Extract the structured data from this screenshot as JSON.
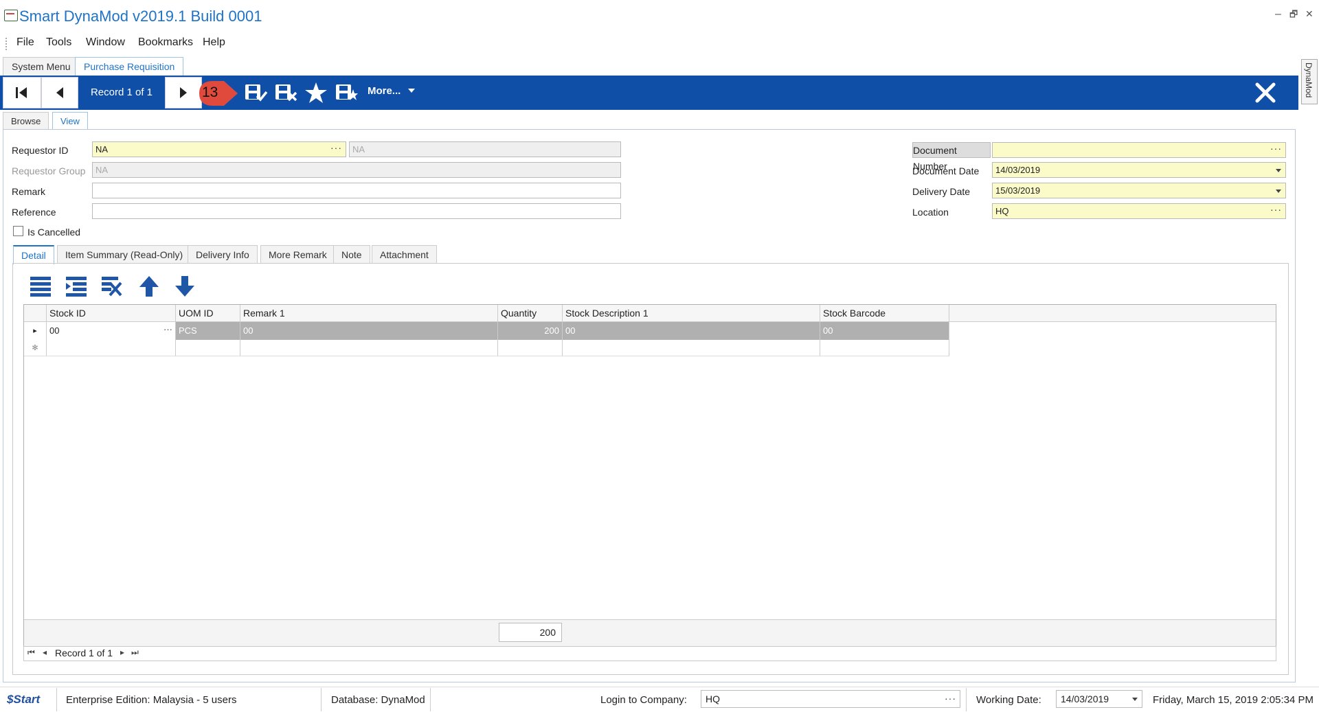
{
  "window": {
    "title": "Smart DynaMod v2019.1 Build 0001",
    "minimize_glyph": "–",
    "restore_glyph": "🗗",
    "close_glyph": "✕"
  },
  "menu": [
    "File",
    "Tools",
    "Window",
    "Bookmarks",
    "Help"
  ],
  "doc_tabs": [
    "System Menu",
    "Purchase Requisition"
  ],
  "side_tab": "DynaMod",
  "toolbar": {
    "record_label": "Record 1 of 1",
    "callout_number": "13",
    "more_label": "More...",
    "accent_color": "#0f4fa8",
    "callout_color": "#e04a3c"
  },
  "view_tabs": [
    "Browse",
    "View"
  ],
  "form": {
    "requestor_id_label": "Requestor ID",
    "requestor_id_value": "NA",
    "requestor_name_value": "NA",
    "requestor_group_label": "Requestor Group",
    "requestor_group_value": "NA",
    "remark_label": "Remark",
    "remark_value": "",
    "reference_label": "Reference",
    "reference_value": "",
    "is_cancelled_label": "Is Cancelled",
    "is_cancelled": false,
    "document_number_label": "Document Number",
    "document_number_value": "",
    "document_date_label": "Document Date",
    "document_date_value": "14/03/2019",
    "delivery_date_label": "Delivery Date",
    "delivery_date_value": "15/03/2019",
    "location_label": "Location",
    "location_value": "HQ",
    "ellipsis": "···"
  },
  "inner_tabs": [
    "Detail",
    "Item Summary (Read-Only)",
    "Delivery Info",
    "More Remark",
    "Note",
    "Attachment"
  ],
  "grid": {
    "columns": [
      "Stock ID",
      "UOM ID",
      "Remark 1",
      "Quantity",
      "Stock Description 1",
      "Stock Barcode"
    ],
    "rows": [
      {
        "stock_id": "00",
        "uom_id": "PCS",
        "remark1": "00",
        "quantity": "200",
        "stock_desc1": "00",
        "stock_barcode": "00"
      }
    ],
    "row_indicator": "▸",
    "new_row_indicator": "✻",
    "footer_quantity_total": "200",
    "nav_record": "Record 1 of 1"
  },
  "statusbar": {
    "start_label": "Start",
    "edition": "Enterprise Edition: Malaysia - 5 users",
    "database": "Database: DynaMod",
    "login_label": "Login to Company:",
    "login_value": "HQ",
    "working_date_label": "Working Date:",
    "working_date_value": "14/03/2019",
    "datetime": "Friday, March 15, 2019 2:05:34 PM"
  }
}
